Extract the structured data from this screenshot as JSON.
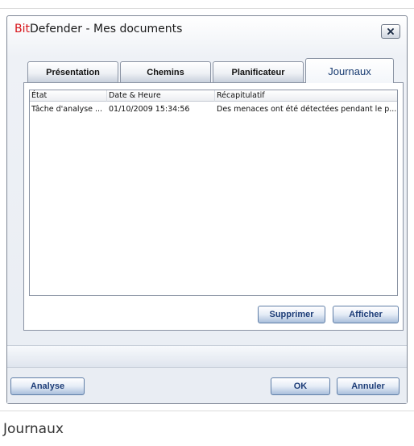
{
  "window": {
    "title_brand": "Bit",
    "title_rest": "Defender - Mes documents"
  },
  "tabs": [
    {
      "label": "Présentation",
      "active": false
    },
    {
      "label": "Chemins",
      "active": false
    },
    {
      "label": "Planificateur",
      "active": false
    },
    {
      "label": "Journaux",
      "active": true
    }
  ],
  "log_table": {
    "columns": [
      "État",
      "Date & Heure",
      "Récapitulatif"
    ],
    "rows": [
      {
        "etat": "Tâche d'analyse ...",
        "date": "01/10/2009 15:34:56",
        "recap": "Des menaces ont été détectées pendant le p..."
      }
    ]
  },
  "panel_actions": {
    "delete_label": "Supprimer",
    "show_label": "Afficher"
  },
  "footer": {
    "analyse_label": "Analyse",
    "ok_label": "OK",
    "cancel_label": "Annuler"
  },
  "caption": "Journaux",
  "colors": {
    "brand_red": "#d7141a",
    "button_text": "#1d3d78",
    "border": "#8a93a3"
  }
}
